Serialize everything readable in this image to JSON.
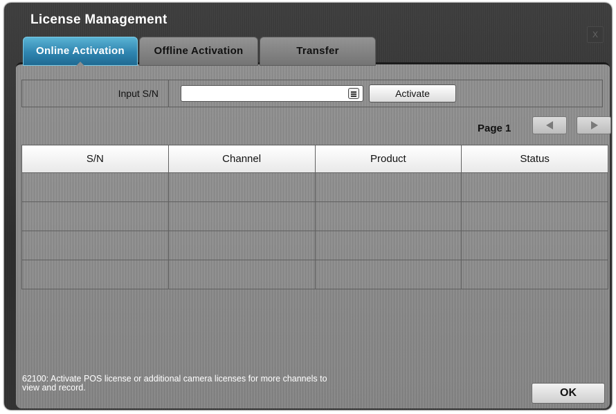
{
  "window": {
    "title": "License Management",
    "close_label": "X"
  },
  "tabs": [
    {
      "label": "Online Activation",
      "active": true
    },
    {
      "label": "Offline Activation",
      "active": false
    },
    {
      "label": "Transfer",
      "active": false
    }
  ],
  "input": {
    "label": "Input S/N",
    "value": "",
    "placeholder": "",
    "activate_label": "Activate"
  },
  "pagination": {
    "page_label": "Page 1"
  },
  "table": {
    "headers": [
      "S/N",
      "Channel",
      "Product",
      "Status"
    ],
    "rows": [
      [
        "",
        "",
        "",
        ""
      ],
      [
        "",
        "",
        "",
        ""
      ],
      [
        "",
        "",
        "",
        ""
      ],
      [
        "",
        "",
        "",
        ""
      ]
    ]
  },
  "footer": {
    "message": "62100: Activate POS license or additional camera licenses for more channels to view and record.",
    "ok_label": "OK"
  },
  "colors": {
    "active_tab": "#2f85b0",
    "panel_bg": "#8a8a8a",
    "window_bg": "#2e2e2e"
  }
}
